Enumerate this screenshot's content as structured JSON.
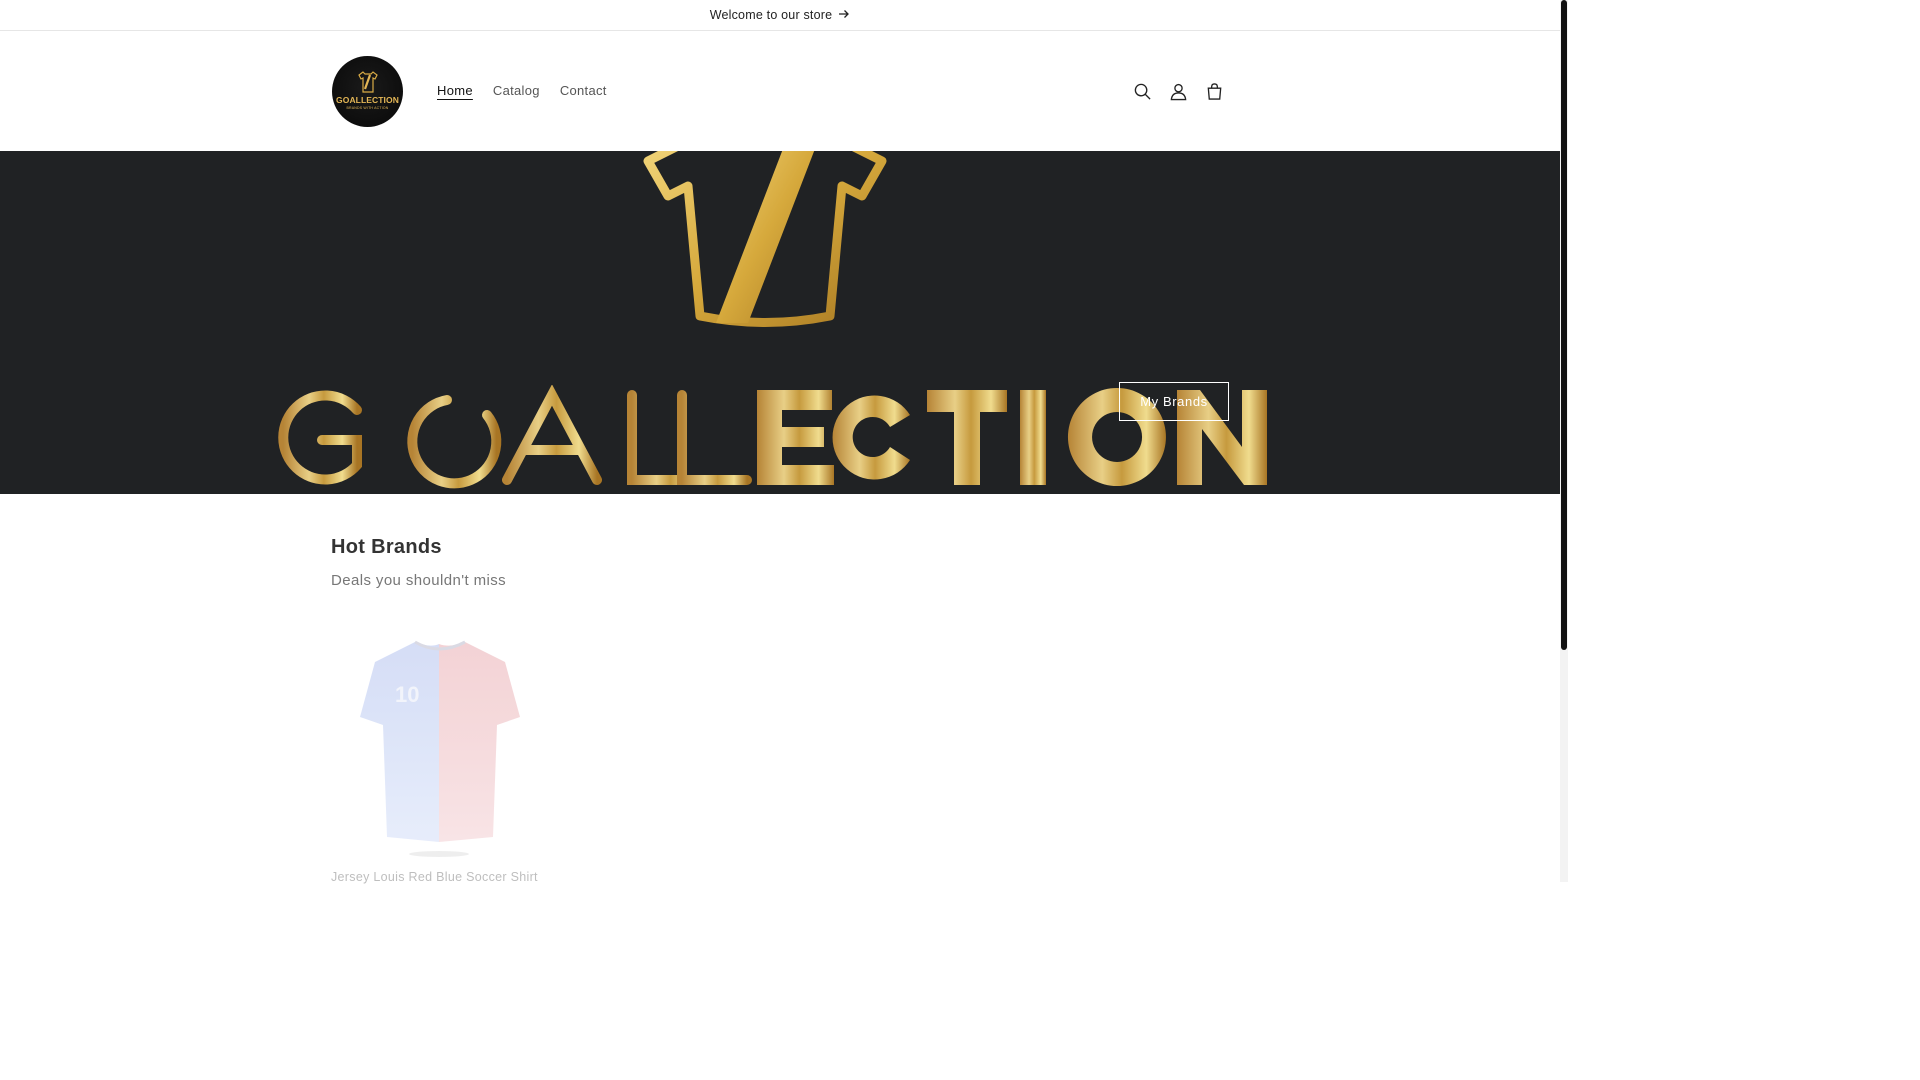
{
  "announcement": {
    "text": "Welcome to our store",
    "icon": "arrow-right-icon"
  },
  "header": {
    "logo": {
      "text": "GOALLECTION",
      "tagline": "BRANDS WITH ACTION"
    },
    "nav": [
      {
        "label": "Home",
        "active": true
      },
      {
        "label": "Catalog",
        "active": false
      },
      {
        "label": "Contact",
        "active": false
      }
    ],
    "icons": [
      "search-icon",
      "account-icon",
      "cart-icon"
    ]
  },
  "hero": {
    "wordmark": "GOALLECTION",
    "button_label": "My Brands",
    "colors": {
      "background": "#202224",
      "gold": "#d4a93a"
    }
  },
  "collection": {
    "title": "Hot Brands",
    "subtitle": "Deals you shouldn't miss",
    "products": [
      {
        "title": "Jersey Louis Red Blue Soccer Shirt"
      }
    ]
  }
}
